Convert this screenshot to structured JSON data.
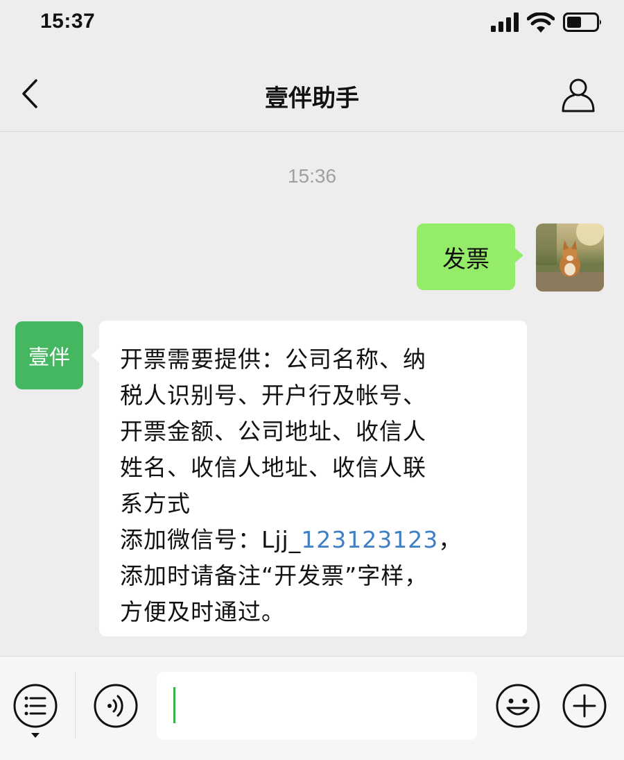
{
  "status_bar": {
    "time": "15:37"
  },
  "header": {
    "title": "壹伴助手"
  },
  "chat": {
    "timestamp": "15:36",
    "sent_message": "发票",
    "bot_avatar_label": "壹伴",
    "received_lines": [
      "开票需要提供：公司名称、纳",
      "税人识别号、开户行及帐号、",
      "开票金额、公司地址、收信人",
      "姓名、收信人地址、收信人联",
      "系方式"
    ],
    "wechat_prefix": "添加微信号：Ljj_",
    "wechat_number": "123123123",
    "wechat_suffix": "，",
    "received_tail_lines": [
      "添加时请备注“开发票”字样，",
      "方便及时通过。"
    ]
  },
  "input_bar": {
    "value": ""
  },
  "colors": {
    "sent_bubble": "#95ec69",
    "bot_avatar": "#45b761",
    "link": "#3f7fc6",
    "caret": "#3cb34a"
  },
  "icons": {
    "back": "chevron-left-icon",
    "profile": "person-icon",
    "menu": "menu-list-icon",
    "voice": "voice-icon",
    "emoji": "emoji-icon",
    "plus": "plus-icon"
  }
}
